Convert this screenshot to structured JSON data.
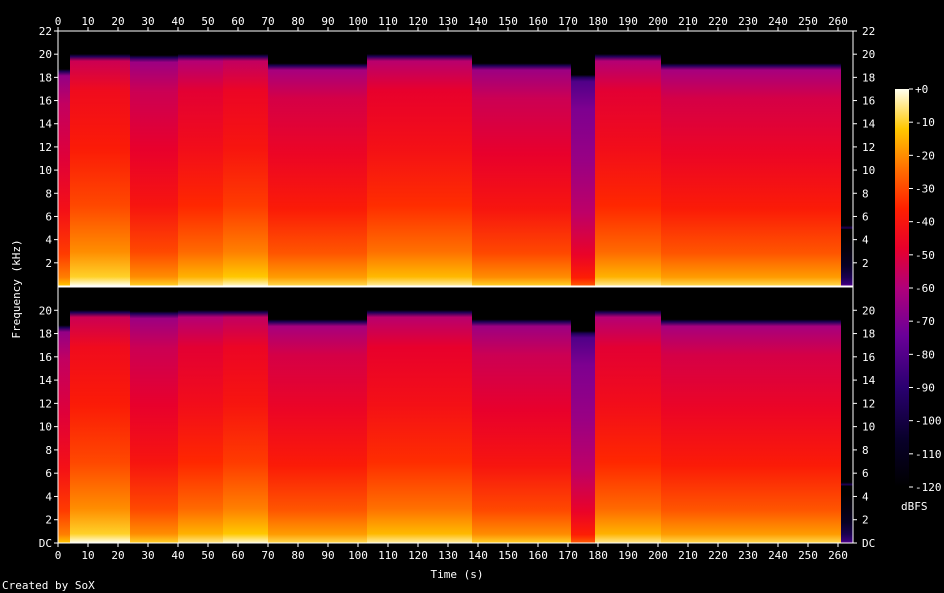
{
  "chart_data": {
    "type": "heatmap",
    "title": "",
    "xlabel": "Time (s)",
    "ylabel": "Frequency (kHz)",
    "xlim": [
      0,
      265
    ],
    "ylim": [
      0,
      22
    ],
    "x_ticks": [
      "0",
      "10",
      "20",
      "30",
      "40",
      "50",
      "60",
      "70",
      "80",
      "90",
      "100",
      "110",
      "120",
      "130",
      "140",
      "150",
      "160",
      "170",
      "180",
      "190",
      "200",
      "210",
      "220",
      "230",
      "240",
      "250",
      "260"
    ],
    "y_ticks_top": [
      "2",
      "4",
      "6",
      "8",
      "10",
      "12",
      "14",
      "16",
      "18",
      "20",
      "22"
    ],
    "y_ticks_bottom": [
      "DC",
      "2",
      "4",
      "6",
      "8",
      "10",
      "12",
      "14",
      "16",
      "18",
      "20"
    ],
    "colorbar": {
      "label": "dBFS",
      "ticks": [
        "+0",
        "-10",
        "-20",
        "-30",
        "-40",
        "-50",
        "-60",
        "-70",
        "-80",
        "-90",
        "-100",
        "-110",
        "-120"
      ],
      "range": [
        -120,
        0
      ]
    },
    "channels": 2,
    "grid": false,
    "credit": "Created by SoX",
    "segments": [
      {
        "start": 0,
        "end": 4,
        "level": -40,
        "cutoff_khz": 18.5
      },
      {
        "start": 4,
        "end": 24,
        "level": -28,
        "cutoff_khz": 19.8
      },
      {
        "start": 24,
        "end": 40,
        "level": -38,
        "cutoff_khz": 19.7
      },
      {
        "start": 40,
        "end": 55,
        "level": -33,
        "cutoff_khz": 19.8
      },
      {
        "start": 55,
        "end": 70,
        "level": -30,
        "cutoff_khz": 19.8
      },
      {
        "start": 70,
        "end": 103,
        "level": -36,
        "cutoff_khz": 19.0
      },
      {
        "start": 103,
        "end": 138,
        "level": -32,
        "cutoff_khz": 19.8
      },
      {
        "start": 138,
        "end": 171,
        "level": -38,
        "cutoff_khz": 19.0
      },
      {
        "start": 171,
        "end": 179,
        "level": -55,
        "cutoff_khz": 18.0
      },
      {
        "start": 179,
        "end": 201,
        "level": -33,
        "cutoff_khz": 19.8
      },
      {
        "start": 201,
        "end": 261,
        "level": -36,
        "cutoff_khz": 19.0
      },
      {
        "start": 261,
        "end": 265,
        "level": -105,
        "cutoff_khz": 5.0
      }
    ],
    "colors": {
      "background": "#000000",
      "text": "#ffffff",
      "frame": "#ffffff"
    }
  }
}
